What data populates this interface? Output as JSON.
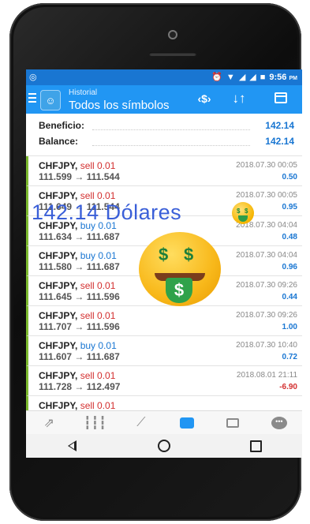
{
  "status_bar": {
    "left_icon": "instagram-icon",
    "icons": [
      "alarm-icon",
      "wifi-icon",
      "signal-icon",
      "signal-icon",
      "battery-icon"
    ],
    "time": "9:56",
    "ampm": "PM"
  },
  "app_bar": {
    "subtitle": "Historial",
    "title": "Todos los símbolos",
    "dollar_label": "‹$›",
    "sort_label": "↓↑"
  },
  "summary": {
    "profit_label": "Beneficio:",
    "profit_value": "142.14",
    "balance_label": "Balance:",
    "balance_value": "142.14"
  },
  "deals": [
    {
      "symbol": "CHFJPY,",
      "side": "sell 0.01",
      "prices": "111.599 → 111.544",
      "time": "2018.07.30 00:05",
      "profit": "0.50"
    },
    {
      "symbol": "CHFJPY,",
      "side": "sell 0.01",
      "prices": "111.649 → 111.544",
      "time": "2018.07.30 00:05",
      "profit": "0.95"
    },
    {
      "symbol": "CHFJPY,",
      "side": "buy 0.01",
      "prices": "111.634 → 111.687",
      "time": "2018.07.30 04:04",
      "profit": "0.48"
    },
    {
      "symbol": "CHFJPY,",
      "side": "buy 0.01",
      "prices": "111.580 → 111.687",
      "time": "2018.07.30 04:04",
      "profit": "0.96"
    },
    {
      "symbol": "CHFJPY,",
      "side": "sell 0.01",
      "prices": "111.645 → 111.596",
      "time": "2018.07.30 09:26",
      "profit": "0.44"
    },
    {
      "symbol": "CHFJPY,",
      "side": "sell 0.01",
      "prices": "111.707 → 111.596",
      "time": "2018.07.30 09:26",
      "profit": "1.00"
    },
    {
      "symbol": "CHFJPY,",
      "side": "buy 0.01",
      "prices": "111.607 → 111.687",
      "time": "2018.07.30 10:40",
      "profit": "0.72"
    },
    {
      "symbol": "CHFJPY,",
      "side": "sell 0.01",
      "prices": "111.728 → 112.497",
      "time": "2018.08.01 21:11",
      "profit": "-6.90"
    },
    {
      "symbol": "CHFJPY,",
      "side": "sell 0.01",
      "prices": "",
      "time": "",
      "profit": ""
    }
  ],
  "tabs": [
    "quotes-icon",
    "chart-icon",
    "trade-icon",
    "history-icon",
    "news-icon",
    "chat-icon"
  ],
  "active_tab": "history-icon",
  "overlay": {
    "text": "142.14 Dólares",
    "small_emoji": "money-mouth-face-icon",
    "big_emoji": "money-mouth-face-icon",
    "money_sign": "$"
  },
  "colors": {
    "app_bar": "#2196f3",
    "status_bar": "#1976d2",
    "sell": "#d32f2f",
    "buy": "#1976d2",
    "accent_bar": "#7dba2f",
    "overlay_text": "#3a5fd8"
  }
}
